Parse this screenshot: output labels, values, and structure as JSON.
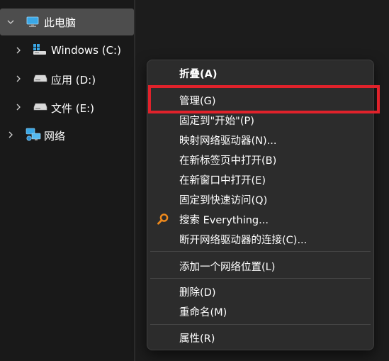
{
  "nav": {
    "items": [
      {
        "label": "此电脑",
        "icon": "computer-icon"
      },
      {
        "label": "Windows (C:)",
        "icon": "system-drive-icon"
      },
      {
        "label": "应用 (D:)",
        "icon": "drive-icon"
      },
      {
        "label": "文件 (E:)",
        "icon": "drive-icon"
      },
      {
        "label": "网络",
        "icon": "network-icon"
      }
    ]
  },
  "menu": {
    "items": [
      {
        "label": "折叠(A)"
      },
      {
        "label": "管理(G)"
      },
      {
        "label": "固定到\"开始\"(P)"
      },
      {
        "label": "映射网络驱动器(N)..."
      },
      {
        "label": "在新标签页中打开(B)"
      },
      {
        "label": "在新窗口中打开(E)"
      },
      {
        "label": "固定到快速访问(Q)"
      },
      {
        "label": "搜索 Everything...",
        "icon": "search-everything-icon"
      },
      {
        "label": "断开网络驱动器的连接(C)..."
      },
      {
        "label": "添加一个网络位置(L)"
      },
      {
        "label": "删除(D)"
      },
      {
        "label": "重命名(M)"
      },
      {
        "label": "属性(R)"
      }
    ]
  },
  "colors": {
    "highlight_box": "#e0222b",
    "selected_bg": "#4d4d4d",
    "menu_bg": "#2c2c2c"
  }
}
